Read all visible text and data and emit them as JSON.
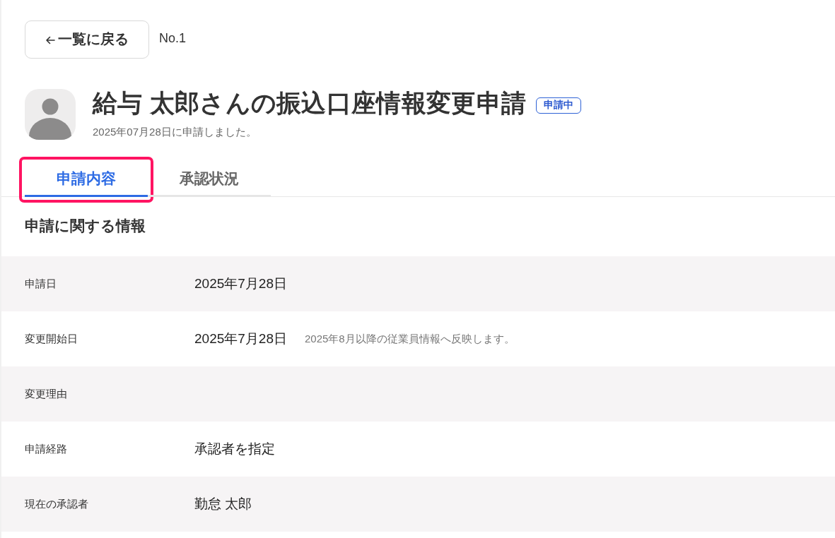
{
  "back_button": {
    "label": "一覧に戻る"
  },
  "record_number": "No.1",
  "header": {
    "title": "給与 太郎さんの振込口座情報変更申請",
    "status_badge": "申請中",
    "subtitle": "2025年07月28日に申請しました。"
  },
  "tabs": [
    {
      "label": "申請内容",
      "selected": true,
      "highlighted": true
    },
    {
      "label": "承認状況",
      "selected": false,
      "highlighted": false
    }
  ],
  "section": {
    "title": "申請に関する情報",
    "rows": [
      {
        "label": "申請日",
        "value": "2025年7月28日"
      },
      {
        "label": "変更開始日",
        "value": "2025年7月28日",
        "note": "2025年8月以降の従業員情報へ反映します。"
      },
      {
        "label": "変更理由"
      },
      {
        "label": "申請経路",
        "value": "承認者を指定"
      },
      {
        "label": "現在の承認者",
        "value": "勤怠 太郎"
      }
    ]
  }
}
